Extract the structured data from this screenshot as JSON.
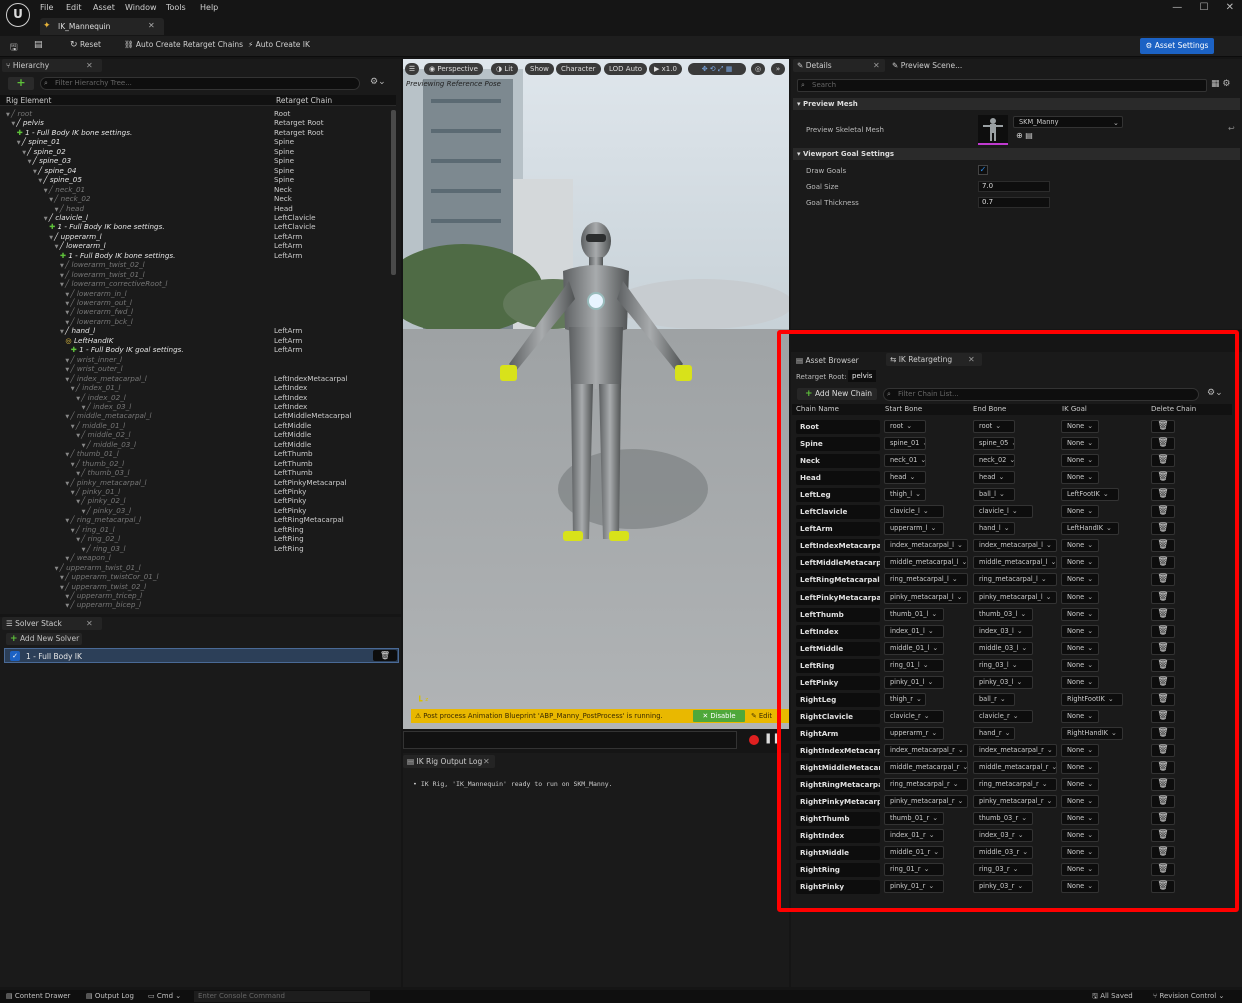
{
  "menu": [
    "File",
    "Edit",
    "Asset",
    "Window",
    "Tools",
    "Help"
  ],
  "doc_tab": "IK_Mannequin",
  "toolbar": {
    "reset": "Reset",
    "auto_chains": "Auto Create Retarget Chains",
    "auto_ik": "Auto Create IK",
    "asset_settings": "Asset Settings"
  },
  "hierarchy": {
    "tab": "Hierarchy",
    "search_placeholder": "Filter Hierarchy Tree...",
    "col_element": "Rig Element",
    "col_chain": "Retarget Chain",
    "rows": [
      {
        "n": "root",
        "c": "Root",
        "d": 0,
        "t": "dim"
      },
      {
        "n": "pelvis",
        "c": "Retarget Root",
        "d": 1,
        "t": "bone"
      },
      {
        "n": "1 - Full Body IK bone settings.",
        "c": "Retarget Root",
        "d": 2,
        "t": "setting"
      },
      {
        "n": "spine_01",
        "c": "Spine",
        "d": 2,
        "t": "bone"
      },
      {
        "n": "spine_02",
        "c": "Spine",
        "d": 3,
        "t": "bone"
      },
      {
        "n": "spine_03",
        "c": "Spine",
        "d": 4,
        "t": "bone"
      },
      {
        "n": "spine_04",
        "c": "Spine",
        "d": 5,
        "t": "bone"
      },
      {
        "n": "spine_05",
        "c": "Spine",
        "d": 6,
        "t": "bone"
      },
      {
        "n": "neck_01",
        "c": "Neck",
        "d": 7,
        "t": "dim"
      },
      {
        "n": "neck_02",
        "c": "Neck",
        "d": 8,
        "t": "dim"
      },
      {
        "n": "head",
        "c": "Head",
        "d": 9,
        "t": "dim"
      },
      {
        "n": "clavicle_l",
        "c": "LeftClavicle",
        "d": 7,
        "t": "bone"
      },
      {
        "n": "1 - Full Body IK bone settings.",
        "c": "LeftClavicle",
        "d": 8,
        "t": "setting"
      },
      {
        "n": "upperarm_l",
        "c": "LeftArm",
        "d": 8,
        "t": "bone"
      },
      {
        "n": "lowerarm_l",
        "c": "LeftArm",
        "d": 9,
        "t": "bone"
      },
      {
        "n": "1 - Full Body IK bone settings.",
        "c": "LeftArm",
        "d": 10,
        "t": "setting"
      },
      {
        "n": "lowerarm_twist_02_l",
        "c": "",
        "d": 10,
        "t": "dim"
      },
      {
        "n": "lowerarm_twist_01_l",
        "c": "",
        "d": 10,
        "t": "dim"
      },
      {
        "n": "lowerarm_correctiveRoot_l",
        "c": "",
        "d": 10,
        "t": "dim"
      },
      {
        "n": "lowerarm_in_l",
        "c": "",
        "d": 11,
        "t": "dim"
      },
      {
        "n": "lowerarm_out_l",
        "c": "",
        "d": 11,
        "t": "dim"
      },
      {
        "n": "lowerarm_fwd_l",
        "c": "",
        "d": 11,
        "t": "dim"
      },
      {
        "n": "lowerarm_bck_l",
        "c": "",
        "d": 11,
        "t": "dim"
      },
      {
        "n": "hand_l",
        "c": "LeftArm",
        "d": 10,
        "t": "bone"
      },
      {
        "n": "LeftHandIK",
        "c": "LeftArm",
        "d": 11,
        "t": "goal"
      },
      {
        "n": "1 - Full Body IK goal settings.",
        "c": "LeftArm",
        "d": 12,
        "t": "setting"
      },
      {
        "n": "wrist_inner_l",
        "c": "",
        "d": 11,
        "t": "dim"
      },
      {
        "n": "wrist_outer_l",
        "c": "",
        "d": 11,
        "t": "dim"
      },
      {
        "n": "index_metacarpal_l",
        "c": "LeftIndexMetacarpal",
        "d": 11,
        "t": "dim"
      },
      {
        "n": "index_01_l",
        "c": "LeftIndex",
        "d": 12,
        "t": "dim"
      },
      {
        "n": "index_02_l",
        "c": "LeftIndex",
        "d": 13,
        "t": "dim"
      },
      {
        "n": "index_03_l",
        "c": "LeftIndex",
        "d": 14,
        "t": "dim"
      },
      {
        "n": "middle_metacarpal_l",
        "c": "LeftMiddleMetacarpal",
        "d": 11,
        "t": "dim"
      },
      {
        "n": "middle_01_l",
        "c": "LeftMiddle",
        "d": 12,
        "t": "dim"
      },
      {
        "n": "middle_02_l",
        "c": "LeftMiddle",
        "d": 13,
        "t": "dim"
      },
      {
        "n": "middle_03_l",
        "c": "LeftMiddle",
        "d": 14,
        "t": "dim"
      },
      {
        "n": "thumb_01_l",
        "c": "LeftThumb",
        "d": 11,
        "t": "dim"
      },
      {
        "n": "thumb_02_l",
        "c": "LeftThumb",
        "d": 12,
        "t": "dim"
      },
      {
        "n": "thumb_03_l",
        "c": "LeftThumb",
        "d": 13,
        "t": "dim"
      },
      {
        "n": "pinky_metacarpal_l",
        "c": "LeftPinkyMetacarpal",
        "d": 11,
        "t": "dim"
      },
      {
        "n": "pinky_01_l",
        "c": "LeftPinky",
        "d": 12,
        "t": "dim"
      },
      {
        "n": "pinky_02_l",
        "c": "LeftPinky",
        "d": 13,
        "t": "dim"
      },
      {
        "n": "pinky_03_l",
        "c": "LeftPinky",
        "d": 14,
        "t": "dim"
      },
      {
        "n": "ring_metacarpal_l",
        "c": "LeftRingMetacarpal",
        "d": 11,
        "t": "dim"
      },
      {
        "n": "ring_01_l",
        "c": "LeftRing",
        "d": 12,
        "t": "dim"
      },
      {
        "n": "ring_02_l",
        "c": "LeftRing",
        "d": 13,
        "t": "dim"
      },
      {
        "n": "ring_03_l",
        "c": "LeftRing",
        "d": 14,
        "t": "dim"
      },
      {
        "n": "weapon_l",
        "c": "",
        "d": 11,
        "t": "dim"
      },
      {
        "n": "upperarm_twist_01_l",
        "c": "",
        "d": 9,
        "t": "dim"
      },
      {
        "n": "upperarm_twistCor_01_l",
        "c": "",
        "d": 10,
        "t": "dim"
      },
      {
        "n": "upperarm_twist_02_l",
        "c": "",
        "d": 10,
        "t": "dim"
      },
      {
        "n": "upperarm_tricep_l",
        "c": "",
        "d": 11,
        "t": "dim"
      },
      {
        "n": "upperarm_bicep_l",
        "c": "",
        "d": 11,
        "t": "dim"
      }
    ]
  },
  "solver": {
    "tab": "Solver Stack",
    "add": "Add New Solver",
    "item": "1 - Full Body IK"
  },
  "viewport": {
    "buttons": [
      "Perspective",
      "Lit",
      "Show",
      "Character",
      "LOD Auto",
      "x1.0"
    ],
    "previewing": "Previewing Reference Pose",
    "warning": "Post process Animation Blueprint 'ABP_Manny_PostProcess' is running.",
    "disable": "Disable",
    "edit": "Edit"
  },
  "outputlog": {
    "tab": "IK Rig Output Log",
    "line": "IK Rig, 'IK_Mannequin' ready to run on SKM_Manny."
  },
  "details": {
    "tab": "Details",
    "tab2": "Preview Scene...",
    "search_placeholder": "Search",
    "section_mesh": "Preview Mesh",
    "mesh_label": "Preview Skeletal Mesh",
    "mesh_value": "SKM_Manny",
    "section_goal": "Viewport Goal Settings",
    "draw_goals": "Draw Goals",
    "goal_size": "Goal Size",
    "goal_size_v": "7.0",
    "goal_thick": "Goal Thickness",
    "goal_thick_v": "0.7"
  },
  "retarget": {
    "tab1": "Asset Browser",
    "tab2": "IK Retargeting",
    "root_label": "Retarget Root:",
    "root_value": "pelvis",
    "add_chain": "Add New Chain",
    "search_placeholder": "Filter Chain List...",
    "headers": [
      "Chain Name",
      "Start Bone",
      "End Bone",
      "IK Goal",
      "Delete Chain"
    ],
    "chains": [
      {
        "n": "Root",
        "s": "root",
        "e": "root",
        "g": "None"
      },
      {
        "n": "Spine",
        "s": "spine_01",
        "e": "spine_05",
        "g": "None"
      },
      {
        "n": "Neck",
        "s": "neck_01",
        "e": "neck_02",
        "g": "None"
      },
      {
        "n": "Head",
        "s": "head",
        "e": "head",
        "g": "None"
      },
      {
        "n": "LeftLeg",
        "s": "thigh_l",
        "e": "ball_l",
        "g": "LeftFootIK"
      },
      {
        "n": "LeftClavicle",
        "s": "clavicle_l",
        "e": "clavicle_l",
        "g": "None"
      },
      {
        "n": "LeftArm",
        "s": "upperarm_l",
        "e": "hand_l",
        "g": "LeftHandIK"
      },
      {
        "n": "LeftIndexMetacarpal",
        "s": "index_metacarpal_l",
        "e": "index_metacarpal_l",
        "g": "None"
      },
      {
        "n": "LeftMiddleMetacarpal",
        "s": "middle_metacarpal_l",
        "e": "middle_metacarpal_l",
        "g": "None"
      },
      {
        "n": "LeftRingMetacarpal",
        "s": "ring_metacarpal_l",
        "e": "ring_metacarpal_l",
        "g": "None"
      },
      {
        "n": "LeftPinkyMetacarpal",
        "s": "pinky_metacarpal_l",
        "e": "pinky_metacarpal_l",
        "g": "None"
      },
      {
        "n": "LeftThumb",
        "s": "thumb_01_l",
        "e": "thumb_03_l",
        "g": "None"
      },
      {
        "n": "LeftIndex",
        "s": "index_01_l",
        "e": "index_03_l",
        "g": "None"
      },
      {
        "n": "LeftMiddle",
        "s": "middle_01_l",
        "e": "middle_03_l",
        "g": "None"
      },
      {
        "n": "LeftRing",
        "s": "ring_01_l",
        "e": "ring_03_l",
        "g": "None"
      },
      {
        "n": "LeftPinky",
        "s": "pinky_01_l",
        "e": "pinky_03_l",
        "g": "None"
      },
      {
        "n": "RightLeg",
        "s": "thigh_r",
        "e": "ball_r",
        "g": "RightFootIK"
      },
      {
        "n": "RightClavicle",
        "s": "clavicle_r",
        "e": "clavicle_r",
        "g": "None"
      },
      {
        "n": "RightArm",
        "s": "upperarm_r",
        "e": "hand_r",
        "g": "RightHandIK"
      },
      {
        "n": "RightIndexMetacarpal",
        "s": "index_metacarpal_r",
        "e": "index_metacarpal_r",
        "g": "None"
      },
      {
        "n": "RightMiddleMetacarpal",
        "s": "middle_metacarpal_r",
        "e": "middle_metacarpal_r",
        "g": "None"
      },
      {
        "n": "RightRingMetacarpal",
        "s": "ring_metacarpal_r",
        "e": "ring_metacarpal_r",
        "g": "None"
      },
      {
        "n": "RightPinkyMetacarpal",
        "s": "pinky_metacarpal_r",
        "e": "pinky_metacarpal_r",
        "g": "None"
      },
      {
        "n": "RightThumb",
        "s": "thumb_01_r",
        "e": "thumb_03_r",
        "g": "None"
      },
      {
        "n": "RightIndex",
        "s": "index_01_r",
        "e": "index_03_r",
        "g": "None"
      },
      {
        "n": "RightMiddle",
        "s": "middle_01_r",
        "e": "middle_03_r",
        "g": "None"
      },
      {
        "n": "RightRing",
        "s": "ring_01_r",
        "e": "ring_03_r",
        "g": "None"
      },
      {
        "n": "RightPinky",
        "s": "pinky_01_r",
        "e": "pinky_03_r",
        "g": "None"
      }
    ]
  },
  "statusbar": {
    "content_drawer": "Content Drawer",
    "output_log": "Output Log",
    "cmd": "Cmd",
    "console_placeholder": "Enter Console Command",
    "saved": "All Saved",
    "revision": "Revision Control"
  },
  "colors": {
    "accent": "#1c62c4",
    "highlight": "#ff0000",
    "green": "#5ec23a"
  }
}
